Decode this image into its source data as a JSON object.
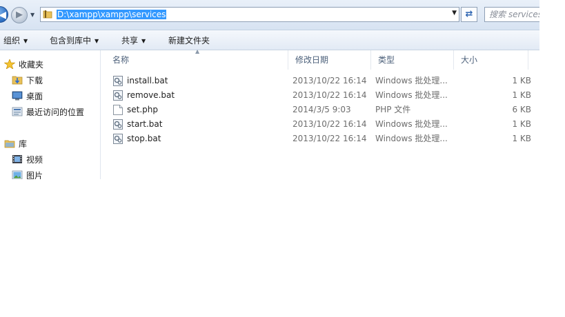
{
  "address": {
    "path": "D:\\xampp\\xampp\\services"
  },
  "search": {
    "placeholder": "搜索 services"
  },
  "toolbar": {
    "organize": "组织",
    "include_in_library": "包含到库中",
    "share": "共享",
    "new_folder": "新建文件夹"
  },
  "nav": {
    "favorites": "收藏夹",
    "favorites_items": [
      "下载",
      "桌面",
      "最近访问的位置"
    ],
    "libraries": "库",
    "library_items": [
      "视频",
      "图片"
    ]
  },
  "columns": {
    "name": "名称",
    "date": "修改日期",
    "type": "类型",
    "size": "大小"
  },
  "files": [
    {
      "name": "install.bat",
      "date": "2013/10/22 16:14",
      "type": "Windows 批处理...",
      "size": "1 KB",
      "icon": "batch-file-icon"
    },
    {
      "name": "remove.bat",
      "date": "2013/10/22 16:14",
      "type": "Windows 批处理...",
      "size": "1 KB",
      "icon": "batch-file-icon"
    },
    {
      "name": "set.php",
      "date": "2014/3/5 9:03",
      "type": "PHP 文件",
      "size": "6 KB",
      "icon": "php-file-icon"
    },
    {
      "name": "start.bat",
      "date": "2013/10/22 16:14",
      "type": "Windows 批处理...",
      "size": "1 KB",
      "icon": "batch-file-icon"
    },
    {
      "name": "stop.bat",
      "date": "2013/10/22 16:14",
      "type": "Windows 批处理...",
      "size": "1 KB",
      "icon": "batch-file-icon"
    }
  ]
}
